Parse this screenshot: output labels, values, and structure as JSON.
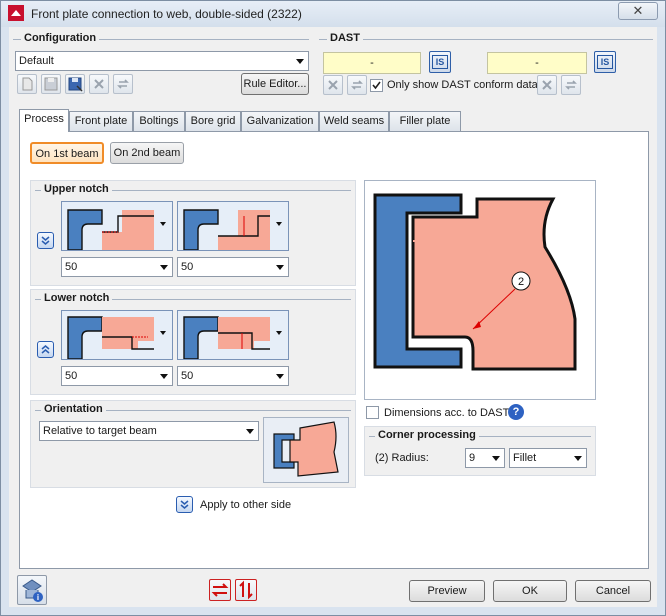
{
  "window": {
    "title": "Front plate connection to web, double-sided (2322)",
    "close_label": "✕"
  },
  "configuration": {
    "title": "Configuration",
    "selected": "Default",
    "rule_editor_label": "Rule Editor..."
  },
  "dast": {
    "title": "DAST",
    "value_left": "-",
    "value_right": "-",
    "is_label": "IS",
    "only_conform_label": "Only show DAST conform data",
    "only_conform_checked": true
  },
  "tabs": [
    "Process",
    "Front plate",
    "Boltings",
    "Bore grid",
    "Galvanization",
    "Weld seams",
    "Filler plate"
  ],
  "beam_buttons": {
    "first": "On 1st beam",
    "second": "On 2nd beam"
  },
  "upper_notch": {
    "title": "Upper notch",
    "value_left": "50",
    "value_right": "50"
  },
  "lower_notch": {
    "title": "Lower notch",
    "value_left": "50",
    "value_right": "50"
  },
  "orientation": {
    "title": "Orientation",
    "selected": "Relative to target beam"
  },
  "apply_other_side_label": "Apply to other side",
  "preview_callout": "2",
  "dimensions_dast_label": "Dimensions acc. to DAST",
  "dimensions_dast_checked": false,
  "corner_processing": {
    "title": "Corner processing",
    "radius_label": "(2) Radius:",
    "radius_value": "9",
    "type_value": "Fillet"
  },
  "footer": {
    "preview_label": "Preview",
    "ok_label": "OK",
    "cancel_label": "Cancel"
  },
  "colors": {
    "steel_blue": "#4a80c0",
    "plate_salmon": "#f7a896",
    "accent_orange": "#f08c28"
  }
}
